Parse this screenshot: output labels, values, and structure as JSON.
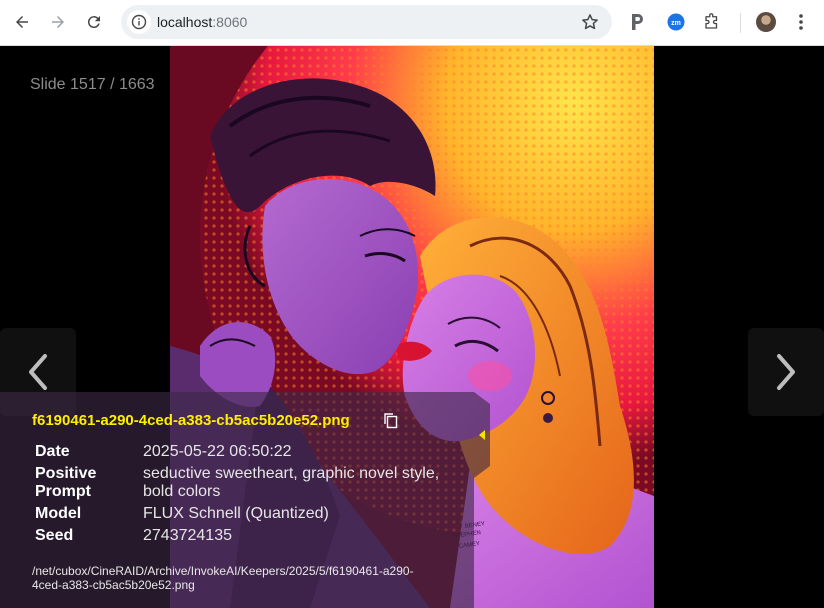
{
  "browser": {
    "url_host": "localhost",
    "url_port": ":8060"
  },
  "viewer": {
    "slide_counter": "Slide 1517 / 1663",
    "file_name": "f6190461-a290-4ced-a383-cb5ac5b20e52.png",
    "metadata": [
      {
        "key": "Date",
        "value": "2025-05-22 06:50:22"
      },
      {
        "key": "Positive Prompt",
        "value": "seductive sweetheart, graphic novel style, bold colors"
      },
      {
        "key": "Model",
        "value": "FLUX Schnell (Quantized)"
      },
      {
        "key": "Seed",
        "value": "2743724135"
      }
    ],
    "file_path": "/net/cubox/CineRAID/Archive/InvokeAI/Keepers/2025/5/f6190461-a290-4ced-a383-cb5ac5b20e52.png",
    "artist_signature": "BENEY STEPHEN CAMEY"
  },
  "icons": [
    "back-icon",
    "forward-icon",
    "reload-icon",
    "site-info-icon",
    "star-icon",
    "p-extension-icon",
    "zm-extension-icon",
    "puzzle-icon",
    "profile-avatar",
    "kebab-menu-icon",
    "copy-icon",
    "chevron-left-icon",
    "chevron-right-icon",
    "collapse-triangle-icon"
  ],
  "colors": {
    "accent_yellow": "#ffee00",
    "overlay": "#3c2846",
    "background": "#000000"
  }
}
